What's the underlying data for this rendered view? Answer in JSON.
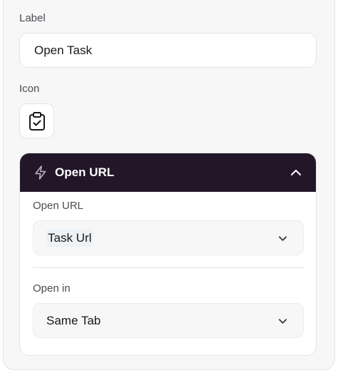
{
  "form": {
    "label_field": {
      "label": "Label",
      "value": "Open Task"
    },
    "icon_field": {
      "label": "Icon",
      "icon": "clipboard-check-icon"
    },
    "action": {
      "title": "Open URL",
      "header_icon": "lightning-bolt-icon",
      "collapse_icon": "chevron-up-icon",
      "url_field": {
        "label": "Open URL",
        "value": "Task Url"
      },
      "open_in_field": {
        "label": "Open in",
        "value": "Same Tab"
      }
    }
  },
  "colors": {
    "header_bg": "#231629",
    "panel_bg": "#f7f7f8"
  }
}
